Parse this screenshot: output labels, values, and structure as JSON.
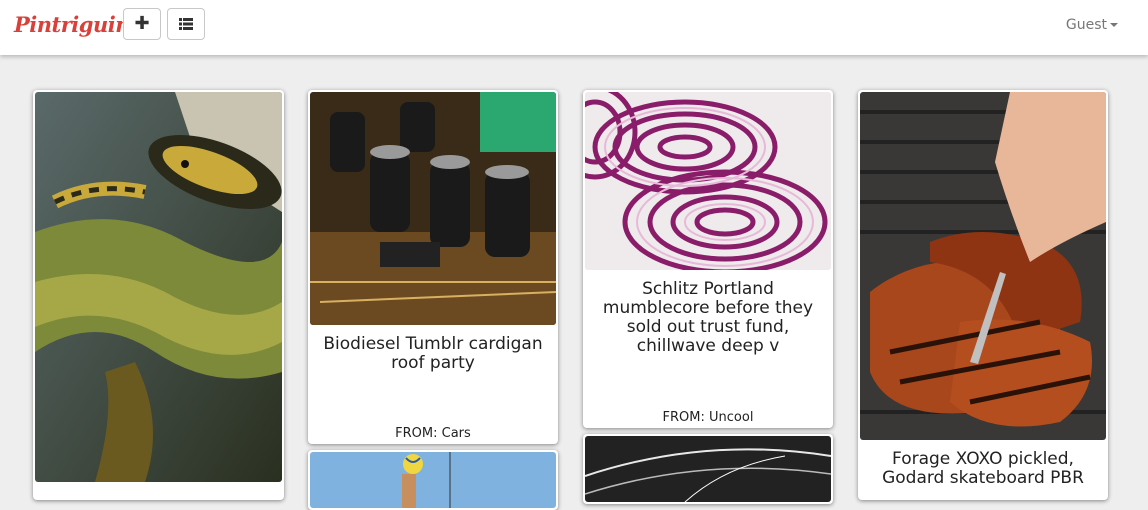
{
  "navbar": {
    "brand": "Pintriguing",
    "add_button_icon": "plus-icon",
    "list_button_icon": "list-icon",
    "user_menu_label": "Guest"
  },
  "cards": [
    {
      "image": "snake-photo",
      "title": "",
      "from": ""
    },
    {
      "image": "circuit-board-photo",
      "title": "Biodiesel Tumblr cardigan roof party",
      "from": "FROM: Cars"
    },
    {
      "image": "red-onion-photo",
      "title": "Schlitz Portland mumblecore before they sold out trust fund, chillwave deep v",
      "from": "FROM: Uncool"
    },
    {
      "image": "grilled-steak-photo",
      "title": "Forage XOXO pickled, Godard skateboard PBR",
      "from": ""
    },
    {
      "image": "volleyball-photo",
      "title": "",
      "from": ""
    },
    {
      "image": "light-trails-photo",
      "title": "",
      "from": ""
    }
  ],
  "colors": {
    "brand": "#d9403a",
    "background": "#eeeeee"
  }
}
